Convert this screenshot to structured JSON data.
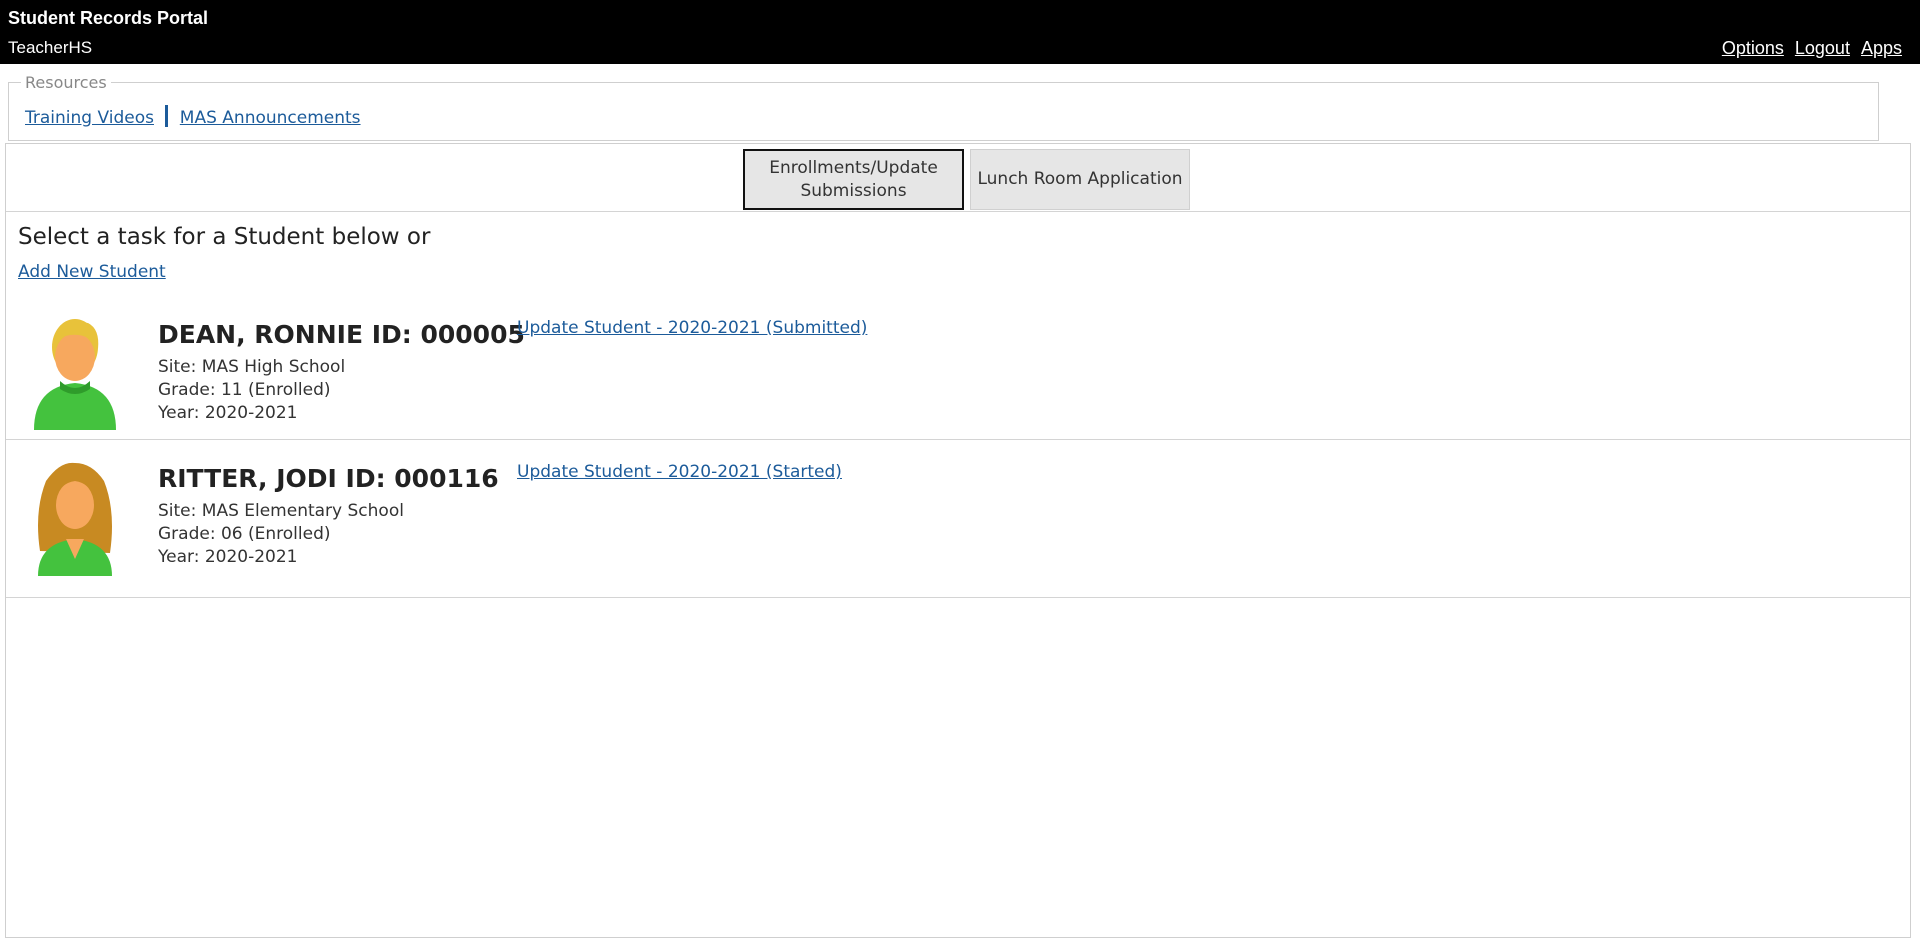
{
  "header": {
    "app_title": "Student Records Portal",
    "user": "TeacherHS",
    "links": [
      "Options",
      "Logout",
      "Apps"
    ]
  },
  "resources": {
    "legend": "Resources",
    "links": [
      "Training Videos",
      "MAS Announcements"
    ]
  },
  "tabs": [
    {
      "label": "Enrollments/Update Submissions",
      "active": true
    },
    {
      "label": "Lunch Room Application",
      "active": false
    }
  ],
  "main": {
    "title": "Select a task for a Student below or",
    "add_link": "Add New Student"
  },
  "students": [
    {
      "name_line": "DEAN, RONNIE ID: 000005",
      "site": "Site: MAS High School",
      "grade": "Grade: 11 (Enrolled)",
      "year": "Year: 2020-2021",
      "action": "Update Student - 2020-2021 (Submitted)",
      "avatar": "male-student-icon"
    },
    {
      "name_line": "RITTER, JODI ID: 000116",
      "site": "Site: MAS Elementary School",
      "grade": "Grade: 06 (Enrolled)",
      "year": "Year: 2020-2021",
      "action": "Update Student - 2020-2021 (Started)",
      "avatar": "female-student-icon"
    }
  ],
  "colors": {
    "header_bg": "#000000",
    "link": "#1c5b9a",
    "avatar_shirt": "#44c23e",
    "avatar_skin": "#f7a85e",
    "hair_blond": "#e8c23a",
    "hair_brown": "#c88a22"
  }
}
